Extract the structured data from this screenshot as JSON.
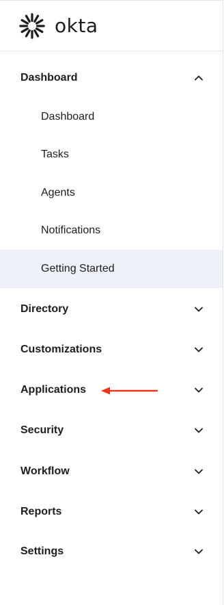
{
  "brand": {
    "logo_text": "okta",
    "logo_icon": "okta-sunburst-icon"
  },
  "nav": {
    "dashboard": {
      "label": "Dashboard",
      "expanded": true,
      "items": [
        {
          "label": "Dashboard"
        },
        {
          "label": "Tasks"
        },
        {
          "label": "Agents"
        },
        {
          "label": "Notifications"
        },
        {
          "label": "Getting Started",
          "active": true
        }
      ]
    },
    "directory": {
      "label": "Directory"
    },
    "customizations": {
      "label": "Customizations"
    },
    "applications": {
      "label": "Applications"
    },
    "security": {
      "label": "Security"
    },
    "workflow": {
      "label": "Workflow"
    },
    "reports": {
      "label": "Reports"
    },
    "settings": {
      "label": "Settings"
    }
  },
  "colors": {
    "text": "#1d1d21",
    "active_bg": "#eef1f8",
    "annotation_arrow": "#e8361f",
    "border": "#e2e4ea"
  }
}
